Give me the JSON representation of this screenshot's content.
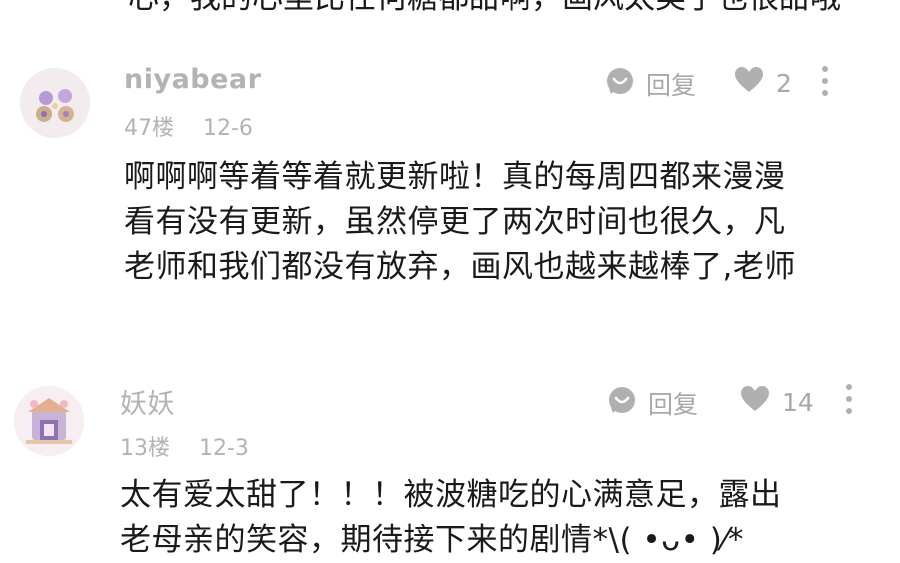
{
  "previous_comment": {
    "clipped_line": "心，我的心里比任何糖都甜啊，画风太美了也很甜哦～"
  },
  "comments": [
    {
      "username": "niyabear",
      "floor": "47楼",
      "date": "12-6",
      "reply_label": "回复",
      "like_count": "2",
      "lines": [
        "啊啊啊等着等着就更新啦！真的每周四都来漫漫",
        "看有没有更新，虽然停更了两次时间也很久，凡",
        "老师和我们都没有放弃，画风也越来越棒了,老师"
      ]
    },
    {
      "username": "妖妖",
      "floor": "13楼",
      "date": "12-3",
      "reply_label": "回复",
      "like_count": "14",
      "lines": [
        "太有爱太甜了！！！被波糖吃的心满意足，露出",
        "老母亲的笑容，期待接下来的剧情*\\( •ᴗ• )⁄*"
      ]
    }
  ],
  "colors": {
    "text_primary": "#1a1a1a",
    "text_muted": "#b3b3b3",
    "icon_gray": "#b0b0b0"
  },
  "icons": [
    "reply-bubble-icon",
    "heart-icon",
    "more-vertical-icon"
  ]
}
